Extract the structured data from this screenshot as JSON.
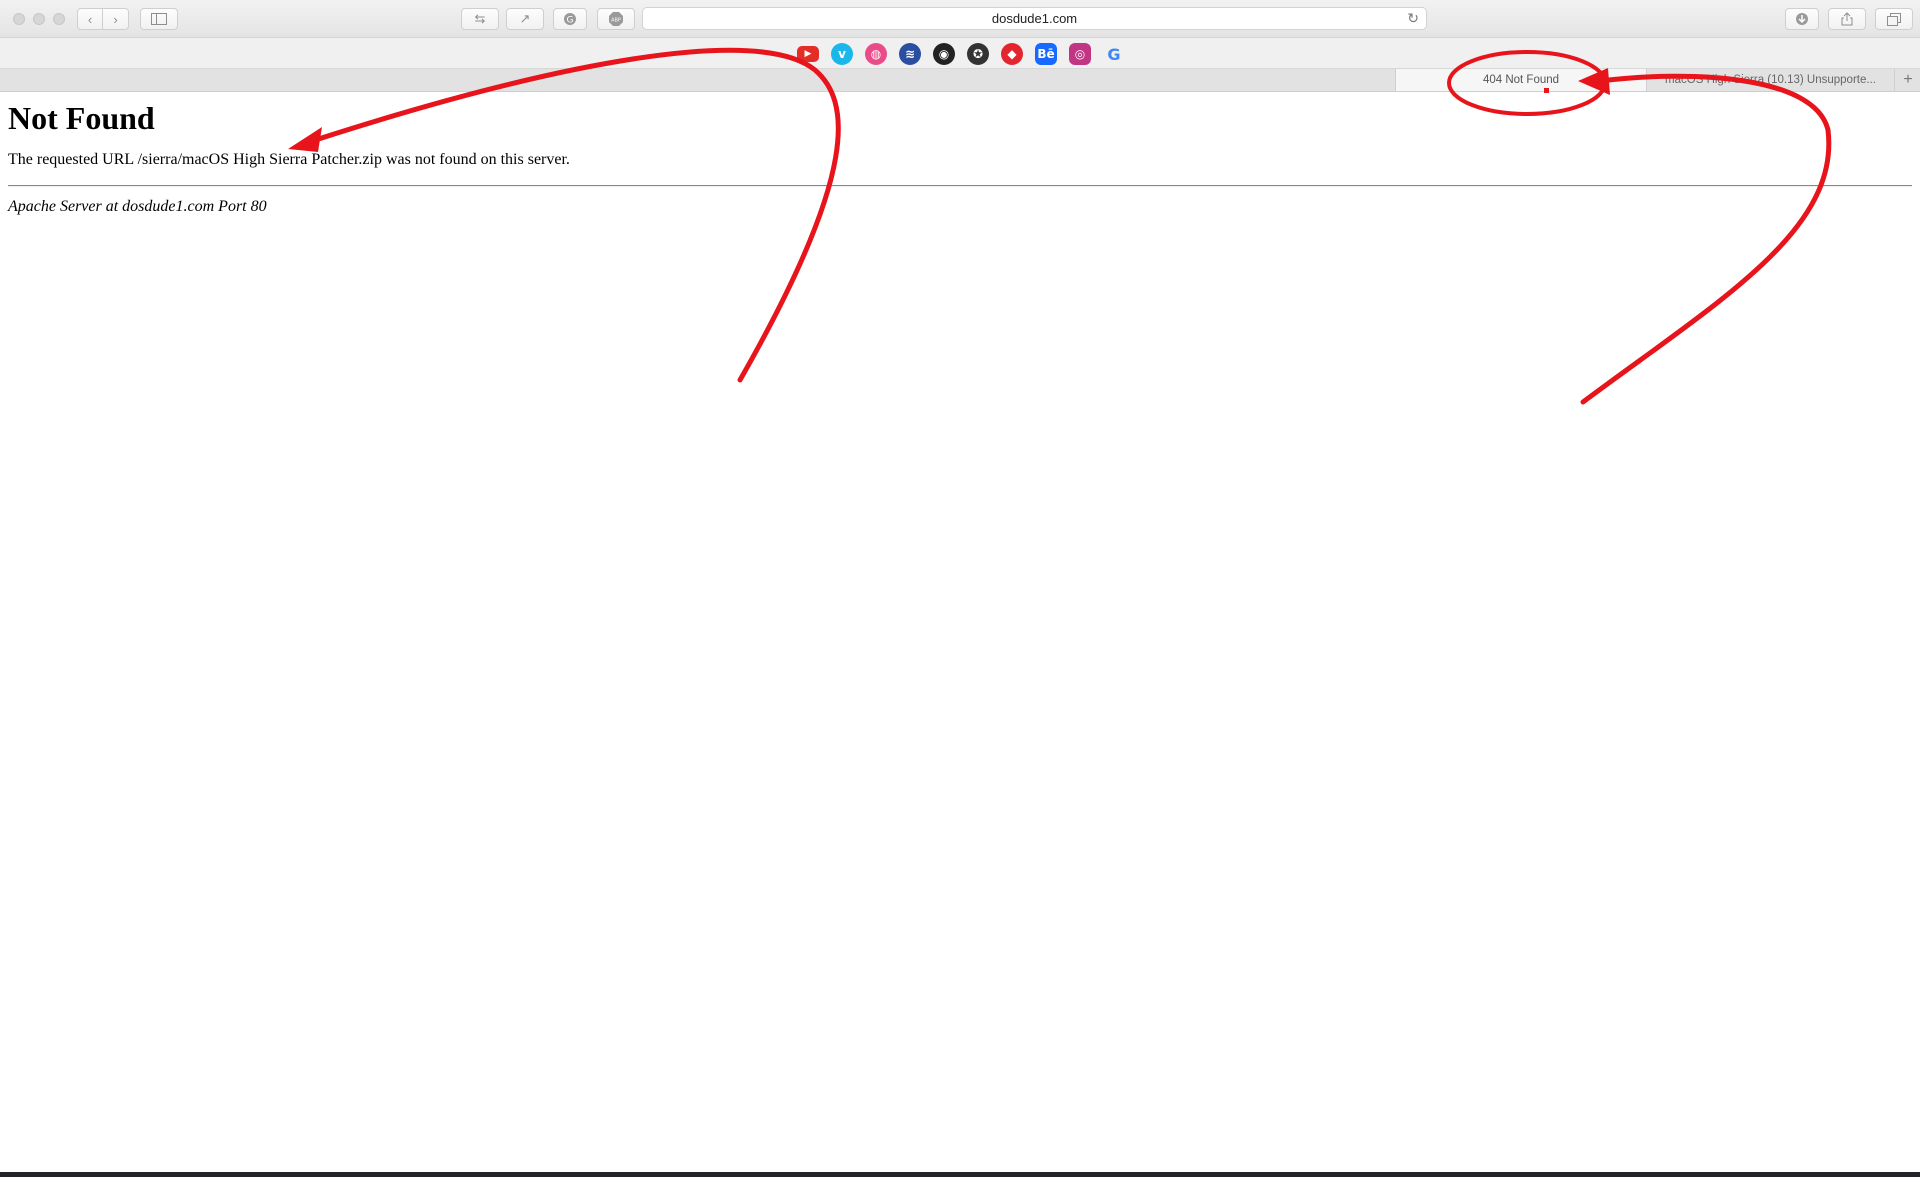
{
  "browser": {
    "address_bar": {
      "url": "dosdude1.com"
    },
    "favorites": [
      {
        "icon": "youtube-icon",
        "color": "#e52d27",
        "glyph": "▶"
      },
      {
        "icon": "vimeo-icon",
        "color": "#1ab7ea",
        "glyph": "v"
      },
      {
        "icon": "dribbble-icon",
        "color": "#ea4c89",
        "glyph": "◍"
      },
      {
        "icon": "layers-icon",
        "color": "#2a4fa0",
        "glyph": "≋"
      },
      {
        "icon": "podcast-icon",
        "color": "#222222",
        "glyph": "◉"
      },
      {
        "icon": "badge-icon",
        "color": "#333333",
        "glyph": "✪"
      },
      {
        "icon": "red-app-icon",
        "color": "#e4252d",
        "glyph": "◆"
      },
      {
        "icon": "behance-icon",
        "color": "#1769ff",
        "glyph": "Bē"
      },
      {
        "icon": "instagram-icon",
        "color": "#c13584",
        "glyph": "◎"
      },
      {
        "icon": "google-icon",
        "color": "#4285f4",
        "glyph": "G"
      }
    ],
    "tabs": [
      {
        "title": "404 Not Found",
        "active": true
      },
      {
        "title": "macOS High Sierra (10.13) Unsupporte...",
        "active": false
      }
    ]
  },
  "page": {
    "heading": "Not Found",
    "message": "The requested URL /sierra/macOS High Sierra Patcher.zip was not found on this server.",
    "server_signature": "Apache Server at dosdude1.com Port 80"
  },
  "annotations": {
    "color": "#e8141c"
  }
}
